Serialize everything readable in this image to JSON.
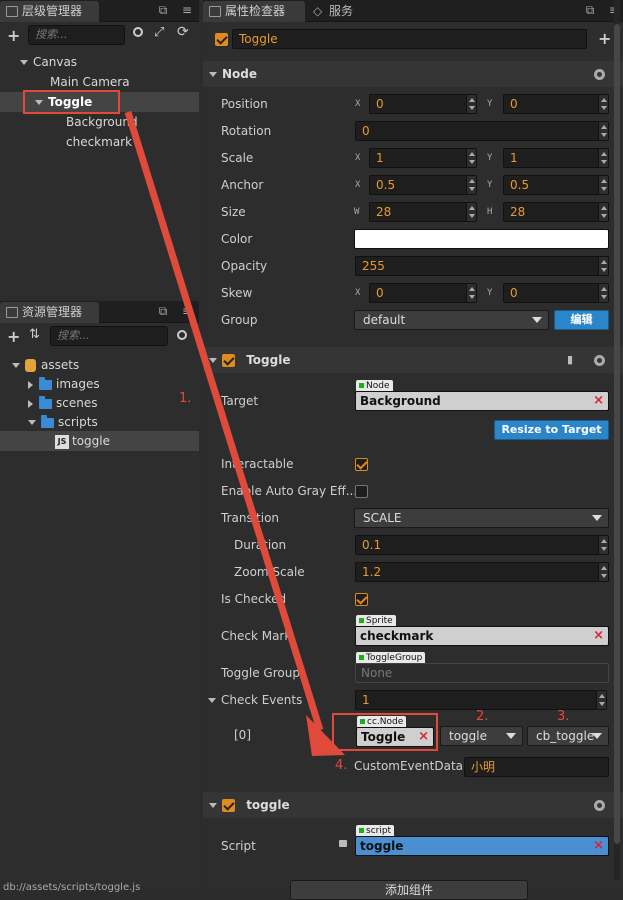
{
  "hierarchy": {
    "tab_label": "层级管理器",
    "search_placeholder": "搜索...",
    "items": [
      "Canvas",
      "Main Camera",
      "Toggle",
      "Background",
      "checkmark"
    ]
  },
  "assets": {
    "tab_label": "资源管理器",
    "search_placeholder": "搜索...",
    "items": [
      "assets",
      "images",
      "scenes",
      "scripts",
      "toggle"
    ],
    "script_badge": "JS"
  },
  "inspector": {
    "tab_label": "属性检查器",
    "tab2_label": "服务",
    "node_name": "Toggle",
    "node_section": "Node",
    "props": {
      "position": {
        "label": "Position",
        "x": "0",
        "y": "0"
      },
      "rotation": {
        "label": "Rotation",
        "value": "0"
      },
      "scale": {
        "label": "Scale",
        "x": "1",
        "y": "1"
      },
      "anchor": {
        "label": "Anchor",
        "x": "0.5",
        "y": "0.5"
      },
      "size": {
        "label": "Size",
        "w": "28",
        "h": "28"
      },
      "color": {
        "label": "Color",
        "value": "#ffffff"
      },
      "opacity": {
        "label": "Opacity",
        "value": "255"
      },
      "skew": {
        "label": "Skew",
        "x": "0",
        "y": "0"
      },
      "group": {
        "label": "Group",
        "value": "default",
        "edit_button": "编辑"
      }
    },
    "axes": {
      "x": "X",
      "y": "Y",
      "w": "W",
      "h": "H"
    },
    "toggle_section": "Toggle",
    "toggle": {
      "target_label": "Target",
      "target_type": "Node",
      "target_value": "Background",
      "resize_button": "Resize to Target",
      "interactable_label": "Interactable",
      "auto_gray_label": "Enable Auto Gray Eff...",
      "transition_label": "Transition",
      "transition_value": "SCALE",
      "duration_label": "Duration",
      "duration_value": "0.1",
      "zoom_label": "Zoom Scale",
      "zoom_value": "1.2",
      "is_checked_label": "Is Checked",
      "check_mark_label": "Check Mark",
      "check_mark_type": "Sprite",
      "check_mark_value": "checkmark",
      "toggle_group_label": "Toggle Group",
      "toggle_group_type": "ToggleGroup",
      "toggle_group_value": "None",
      "check_events_label": "Check Events",
      "check_events_count": "1",
      "event_index": "[0]",
      "event_node_type": "cc.Node",
      "event_node_value": "Toggle",
      "event_component": "toggle",
      "event_handler": "cb_toggle",
      "custom_data_label": "CustomEventData",
      "custom_data_value": "小明"
    },
    "script_section": "toggle",
    "script": {
      "label": "Script",
      "type": "script",
      "value": "toggle"
    },
    "add_component": "添加组件"
  },
  "annotations": [
    "1.",
    "2.",
    "3.",
    "4."
  ],
  "footer_path": "db://assets/scripts/toggle.js"
}
